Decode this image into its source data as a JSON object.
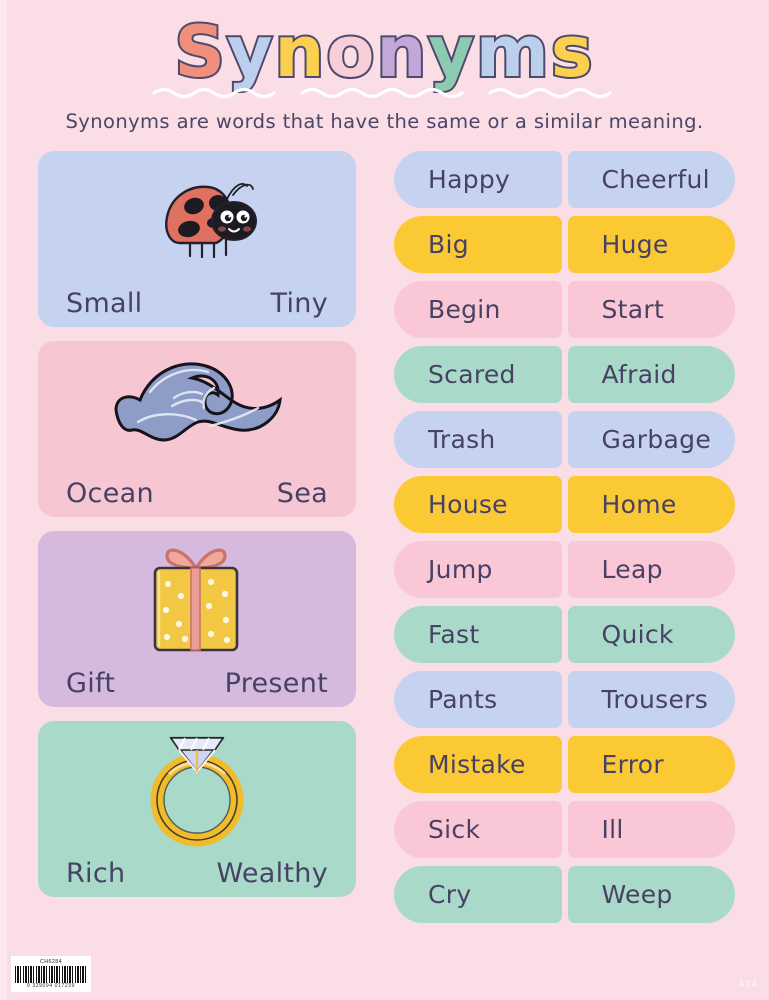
{
  "poster": {
    "background_color": "#fbdde5",
    "title": "Synonyms",
    "title_letters": [
      {
        "char": "S",
        "color": "#ef8f7c"
      },
      {
        "char": "y",
        "color": "#bcd0ee"
      },
      {
        "char": "n",
        "color": "#fbd04e"
      },
      {
        "char": "o",
        "color": "#f8cfd9"
      },
      {
        "char": "n",
        "color": "#c3a7d8"
      },
      {
        "char": "y",
        "color": "#8ccbb0"
      },
      {
        "char": "m",
        "color": "#bcd0ee"
      },
      {
        "char": "s",
        "color": "#fbd04e"
      }
    ],
    "title_outline_color": "#4e4a6e",
    "subtitle": "Synonyms are words that have the same or a similar meaning.",
    "text_color": "#474265"
  },
  "picture_cards": [
    {
      "word_left": "Small",
      "word_right": "Tiny",
      "background": "#c6d3f0",
      "icon": "ladybug-icon"
    },
    {
      "word_left": "Ocean",
      "word_right": "Sea",
      "background": "#f7c6d3",
      "icon": "wave-icon"
    },
    {
      "word_left": "Gift",
      "word_right": "Present",
      "background": "#d5bade",
      "icon": "gift-box-icon"
    },
    {
      "word_left": "Rich",
      "word_right": "Wealthy",
      "background": "#a9dac9",
      "icon": "diamond-ring-icon"
    }
  ],
  "word_pairs": [
    {
      "left": "Happy",
      "right": "Cheerful",
      "color": "#c6d3f0"
    },
    {
      "left": "Big",
      "right": "Huge",
      "color": "#fbc934"
    },
    {
      "left": "Begin",
      "right": "Start",
      "color": "#f9c7d6"
    },
    {
      "left": "Scared",
      "right": "Afraid",
      "color": "#a9dac9"
    },
    {
      "left": "Trash",
      "right": "Garbage",
      "color": "#c6d3f0"
    },
    {
      "left": "House",
      "right": "Home",
      "color": "#fbc934"
    },
    {
      "left": "Jump",
      "right": "Leap",
      "color": "#f9c7d6"
    },
    {
      "left": "Fast",
      "right": "Quick",
      "color": "#a9dac9"
    },
    {
      "left": "Pants",
      "right": "Trousers",
      "color": "#c6d3f0"
    },
    {
      "left": "Mistake",
      "right": "Error",
      "color": "#fbc934"
    },
    {
      "left": "Sick",
      "right": "Ill",
      "color": "#f9c7d6"
    },
    {
      "left": "Cry",
      "right": "Weep",
      "color": "#a9dac9"
    }
  ],
  "barcode": {
    "code": "CH6284",
    "digits": "9 329094 017239"
  },
  "corner_mark": "ATA"
}
